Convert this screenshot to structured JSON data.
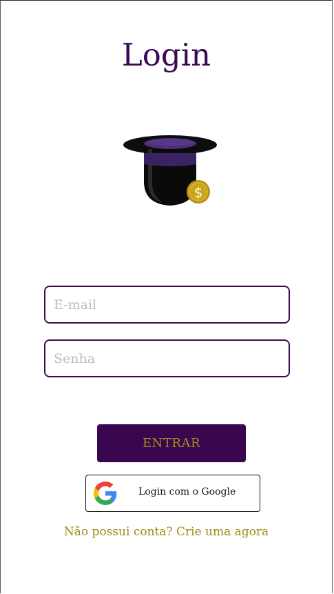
{
  "page": {
    "title": "Login"
  },
  "logo": {
    "icon": "top-hat-with-coin-icon",
    "coin_symbol": "$"
  },
  "form": {
    "email_placeholder": "E-mail",
    "email_value": "",
    "password_placeholder": "Senha",
    "password_value": "",
    "submit_label": "ENTRAR"
  },
  "google": {
    "icon": "google-g-icon",
    "label": "Login com o Google"
  },
  "signup": {
    "link_text": "Não possui conta? Crie uma agora"
  },
  "colors": {
    "primary": "#3a064f",
    "accent_gold": "#a08a12",
    "placeholder": "#bdbdbd",
    "background": "#ffffff"
  }
}
